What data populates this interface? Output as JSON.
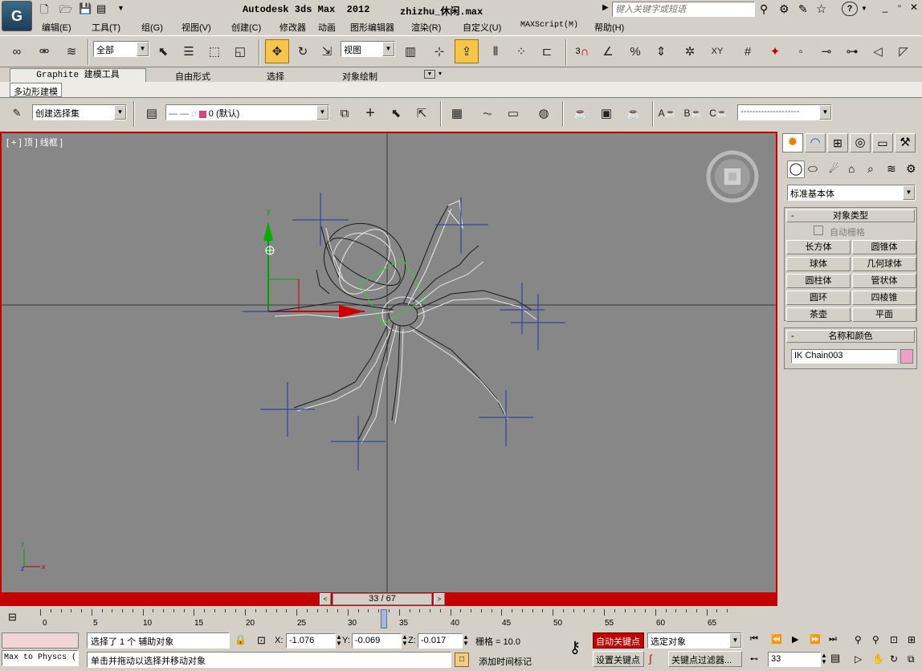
{
  "title_bar": {
    "app_title": "Autodesk 3ds Max  2012",
    "file_name": "zhizhu_休闲.max",
    "search_placeholder": "键入关键字或短语"
  },
  "menu": [
    "编辑(E)",
    "工具(T)",
    "组(G)",
    "视图(V)",
    "创建(C)",
    "修改器",
    "动画",
    "图形编辑器",
    "渲染(R)",
    "自定义(U)",
    "MAXScript(M)",
    "帮助(H)"
  ],
  "main_toolbar": {
    "selection_filter": "全部",
    "ref_coord": "视图",
    "snap_label": "3"
  },
  "ribbon": {
    "tabs": [
      "Graphite 建模工具",
      "自由形式",
      "选择",
      "对象绘制"
    ],
    "subtab": "多边形建模"
  },
  "layer_toolbar": {
    "named_selection": "创建选择集",
    "layer_name": "0 (默认)",
    "abc_labels": [
      "A",
      "B",
      "C"
    ]
  },
  "viewport": {
    "label": "[ + ] 顶 ] 线框 ]",
    "axis_y": "y",
    "axis_x": "x",
    "axis_z": "z"
  },
  "command_panel": {
    "category_dropdown": "标准基本体",
    "object_type_header": "对象类型",
    "autogrid_label": "自动栅格",
    "object_buttons": [
      "长方体",
      "圆锥体",
      "球体",
      "几何球体",
      "圆柱体",
      "管状体",
      "圆环",
      "四棱锥",
      "茶壶",
      "平面"
    ],
    "name_color_header": "名称和颜色",
    "object_name": "IK Chain003",
    "object_color": "#f0a0c8"
  },
  "time_slider": {
    "position": "33 / 67",
    "current_frame": 33,
    "total_frames": 67,
    "ticks": [
      "0",
      "5",
      "10",
      "15",
      "20",
      "25",
      "30",
      "35",
      "40",
      "45",
      "50",
      "55",
      "60",
      "65"
    ]
  },
  "status": {
    "script_listener": "Max to Physcs (",
    "selection_info": "选择了 1 个 辅助对象",
    "prompt": "单击并拖动以选择并移动对象",
    "x_label": "X:",
    "x_value": "-1.076",
    "y_label": "Y:",
    "y_value": "-0.069",
    "z_label": "Z:",
    "z_value": "-0.017",
    "grid": "栅格 = 10.0",
    "add_time_tag": "添加时间标记",
    "auto_key": "自动关键点",
    "set_key": "设置关键点",
    "key_mode": "选定对象",
    "key_filters": "关键点过滤器...",
    "frame_value": "33"
  }
}
